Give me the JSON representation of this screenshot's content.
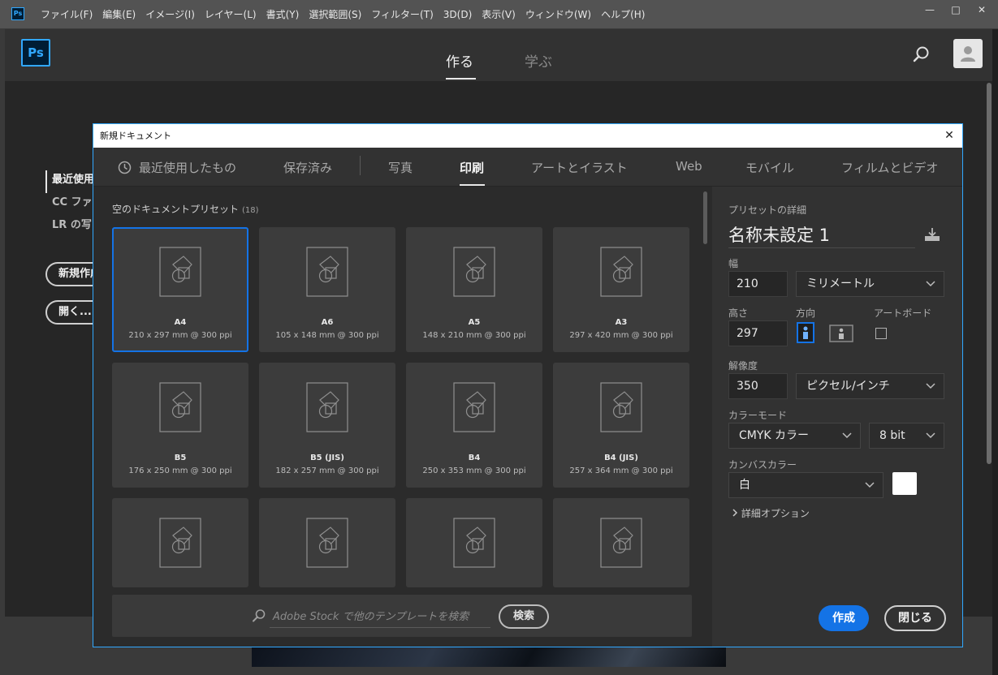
{
  "app": {
    "icon_label": "Ps",
    "logo_label": "Ps"
  },
  "menu": [
    "ファイル(F)",
    "編集(E)",
    "イメージ(I)",
    "レイヤー(L)",
    "書式(Y)",
    "選択範囲(S)",
    "フィルター(T)",
    "3D(D)",
    "表示(V)",
    "ウィンドウ(W)",
    "ヘルプ(H)"
  ],
  "window_controls": {
    "minimize": "—",
    "maximize": "□",
    "close": "✕"
  },
  "home": {
    "tabs": [
      "作る",
      "学ぶ"
    ],
    "active_tab": "作る",
    "sidebar": [
      "最近使用",
      "CC ファ",
      "LR の写"
    ],
    "buttons": [
      "新規作成",
      "開く..."
    ]
  },
  "dialog": {
    "title": "新規ドキュメント",
    "close": "✕",
    "tabs": [
      "最近使用したもの",
      "保存済み",
      "写真",
      "印刷",
      "アートとイラスト",
      "Web",
      "モバイル",
      "フィルムとビデオ"
    ],
    "active_tab": "印刷",
    "presets_heading": "空のドキュメントプリセット",
    "presets_count": "(18)",
    "presets": [
      {
        "name": "A4",
        "size": "210 x 297 mm @ 300 ppi",
        "selected": true
      },
      {
        "name": "A6",
        "size": "105 x 148 mm @ 300 ppi"
      },
      {
        "name": "A5",
        "size": "148 x 210 mm @ 300 ppi"
      },
      {
        "name": "A3",
        "size": "297 x 420 mm @ 300 ppi"
      },
      {
        "name": "B5",
        "size": "176 x 250 mm @ 300 ppi"
      },
      {
        "name": "B5 (JIS)",
        "size": "182 x 257 mm @ 300 ppi"
      },
      {
        "name": "B4",
        "size": "250 x 353 mm @ 300 ppi"
      },
      {
        "name": "B4 (JIS)",
        "size": "257 x 364 mm @ 300 ppi"
      },
      {
        "name": "",
        "size": ""
      },
      {
        "name": "",
        "size": ""
      },
      {
        "name": "",
        "size": ""
      },
      {
        "name": "",
        "size": ""
      }
    ],
    "stock": {
      "placeholder": "Adobe Stock で他のテンプレートを検索",
      "button": "検索"
    },
    "details": {
      "heading": "プリセットの詳細",
      "name": "名称未設定 1",
      "width_label": "幅",
      "width_value": "210",
      "unit": "ミリメートル",
      "height_label": "高さ",
      "height_value": "297",
      "orientation_label": "方向",
      "orientation": "portrait",
      "artboard_label": "アートボード",
      "artboard_checked": false,
      "resolution_label": "解像度",
      "resolution_value": "350",
      "resolution_unit": "ピクセル/インチ",
      "color_mode_label": "カラーモード",
      "color_mode": "CMYK カラー",
      "bit_depth": "8 bit",
      "canvas_color_label": "カンバスカラー",
      "canvas_color": "白",
      "canvas_swatch": "#ffffff",
      "advanced": "詳細オプション"
    },
    "create_button": "作成",
    "close_button": "閉じる"
  },
  "colors": {
    "accent": "#1473e6",
    "ps_blue": "#31a8ff",
    "dialog_bg": "#2b2b2b"
  }
}
